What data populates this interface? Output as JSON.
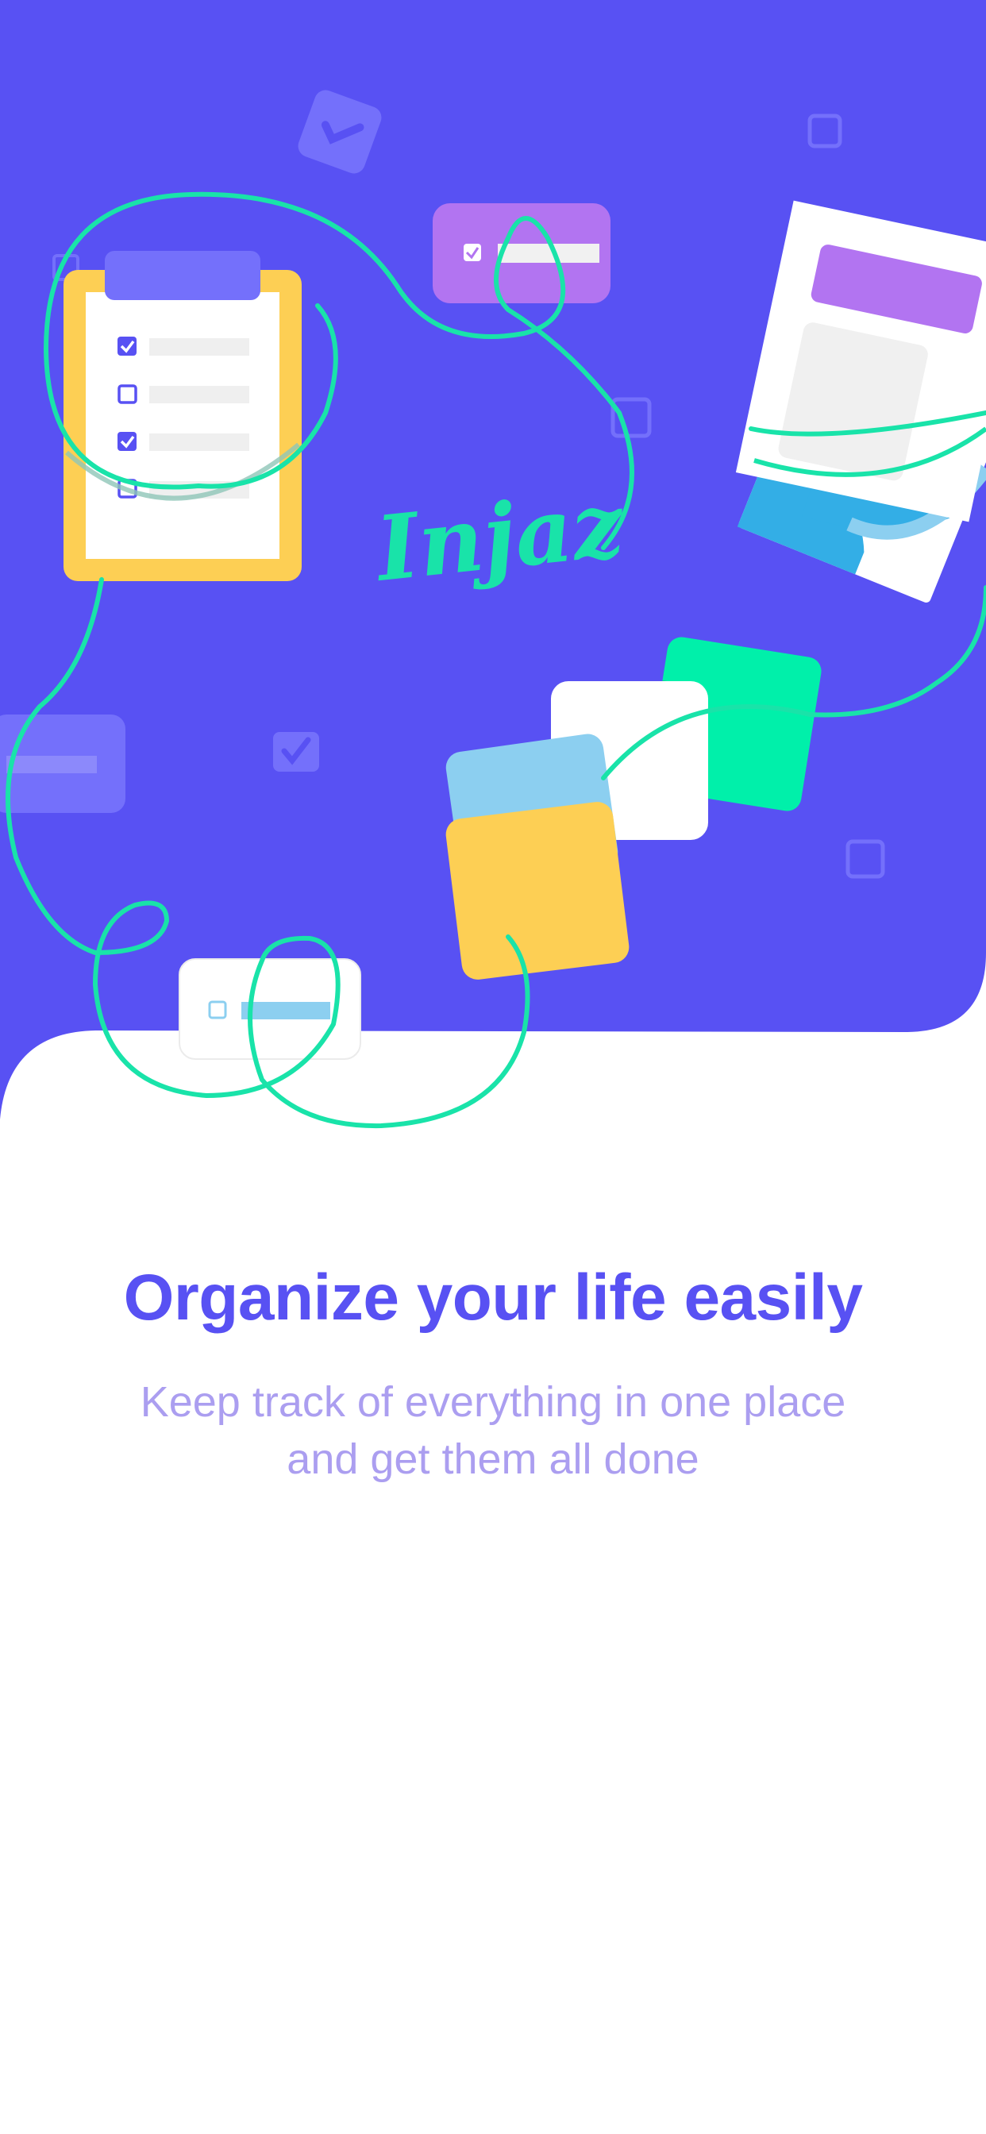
{
  "illustration": {
    "logo_text": "Injaz",
    "colors": {
      "primary": "#5851f3",
      "accent_green": "#19e3a9",
      "yellow": "#fdcf54",
      "purple": "#b274f1",
      "light_blue": "#8ccff0"
    },
    "clipboard_checklist": [
      {
        "checked": true
      },
      {
        "checked": false
      },
      {
        "checked": true
      },
      {
        "checked": false
      }
    ]
  },
  "onboarding": {
    "headline": "Organize your life easily",
    "subtitle_line1": "Keep track of everything in one place",
    "subtitle_line2": "and get them all done"
  }
}
